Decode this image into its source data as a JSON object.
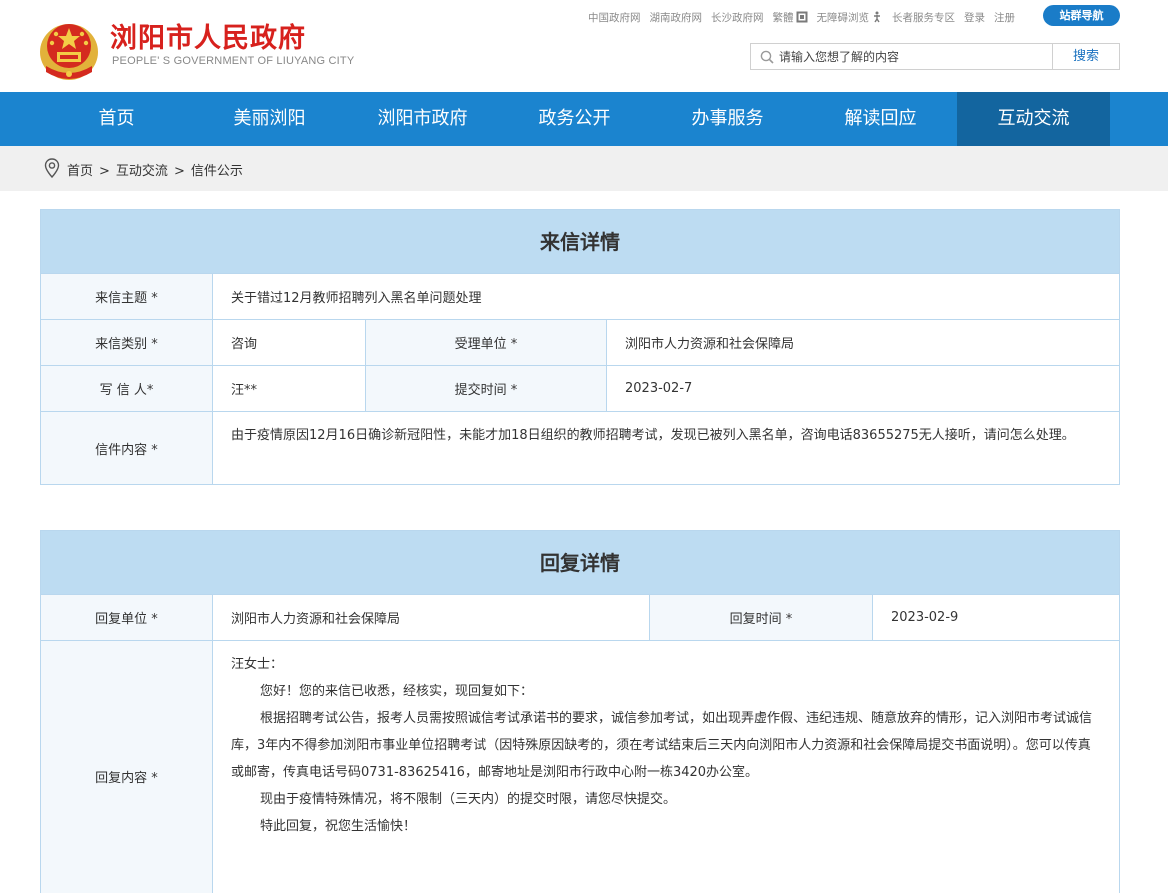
{
  "site": {
    "title": "浏阳市人民政府",
    "subtitle": "PEOPLE'  S GOVERNMENT OF LIUYANG CITY"
  },
  "toplinks": {
    "china_gov": "中国政府网",
    "hunan_gov": "湖南政府网",
    "changsha_gov": "长沙政府网",
    "traditional": "繁體",
    "accessible": "无障碍浏览",
    "elderly": "长者服务专区",
    "login": "登录",
    "register": "注册",
    "site_nav": "站群导航"
  },
  "search": {
    "placeholder": "请输入您想了解的内容",
    "button": "搜索"
  },
  "nav": {
    "items": [
      "首页",
      "美丽浏阳",
      "浏阳市政府",
      "政务公开",
      "办事服务",
      "解读回应",
      "互动交流"
    ],
    "active": "互动交流"
  },
  "breadcrumb": {
    "home": "首页",
    "section": "互动交流",
    "page": "信件公示",
    "separator": ">"
  },
  "letter": {
    "heading": "来信详情",
    "subject_label": "来信主题 *",
    "subject": "关于错过12月教师招聘列入黑名单问题处理",
    "category_label": "来信类别 *",
    "category": "咨询",
    "dept_label": "受理单位 *",
    "dept": "浏阳市人力资源和社会保障局",
    "writer_label": "写 信 人*",
    "writer": "汪**",
    "submit_label": "提交时间 *",
    "submit_time": "2023-02-7",
    "content_label": "信件内容 *",
    "content": "由于疫情原因12月16日确诊新冠阳性，未能才加18日组织的教师招聘考试，发现已被列入黑名单，咨询电话83655275无人接听，请问怎么处理。"
  },
  "reply": {
    "heading": "回复详情",
    "dept_label": "回复单位 *",
    "dept": "浏阳市人力资源和社会保障局",
    "time_label": "回复时间 *",
    "time": "2023-02-9",
    "content_label": "回复内容 *",
    "greeting": "汪女士：",
    "p1": "您好！您的来信已收悉，经核实，现回复如下：",
    "p2": "根据招聘考试公告，报考人员需按照诚信考试承诺书的要求，诚信参加考试，如出现弄虚作假、违纪违规、随意放弃的情形，记入浏阳市考试诚信库，3年内不得参加浏阳市事业单位招聘考试（因特殊原因缺考的，须在考试结束后三天内向浏阳市人力资源和社会保障局提交书面说明）。您可以传真或邮寄，传真电话号码0731-83625416，邮寄地址是浏阳市行政中心附一栋3420办公室。",
    "p3": "现由于疫情特殊情况，将不限制（三天内）的提交时限，请您尽快提交。",
    "p4": "特此回复，祝您生活愉快！"
  },
  "colors": {
    "brand_red": "#d7211d",
    "nav_blue": "#1b84cf",
    "nav_active": "#13659f",
    "panel_head": "#bddcf2",
    "border": "#b9d7ee"
  }
}
